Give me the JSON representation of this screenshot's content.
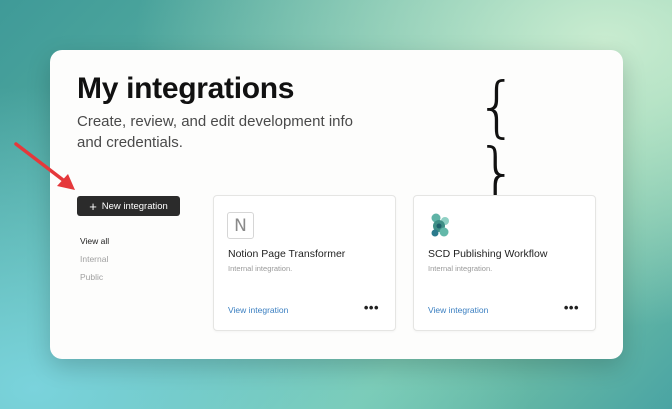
{
  "page": {
    "title": "My integrations",
    "description": "Create, review, and edit development info and credentials."
  },
  "header_icon": "curly-braces-icon",
  "header_icon_glyph": "{ }",
  "new_integration": {
    "icon": "+",
    "label": "New integration"
  },
  "filters": [
    "View all",
    "Internal",
    "Public"
  ],
  "cards": [
    {
      "logo": "N",
      "title": "Notion Page Transformer",
      "subtitle": "Internal integration.",
      "link": "View integration",
      "more": "•••"
    },
    {
      "logo": "scd-logo",
      "title": "SCD Publishing Workflow",
      "subtitle": "Internal integration.",
      "link": "View integration",
      "more": "•••"
    }
  ],
  "colors": {
    "arrow": "#e5383b",
    "button_bg": "#2b2b2b",
    "link": "#3a7fc1"
  }
}
